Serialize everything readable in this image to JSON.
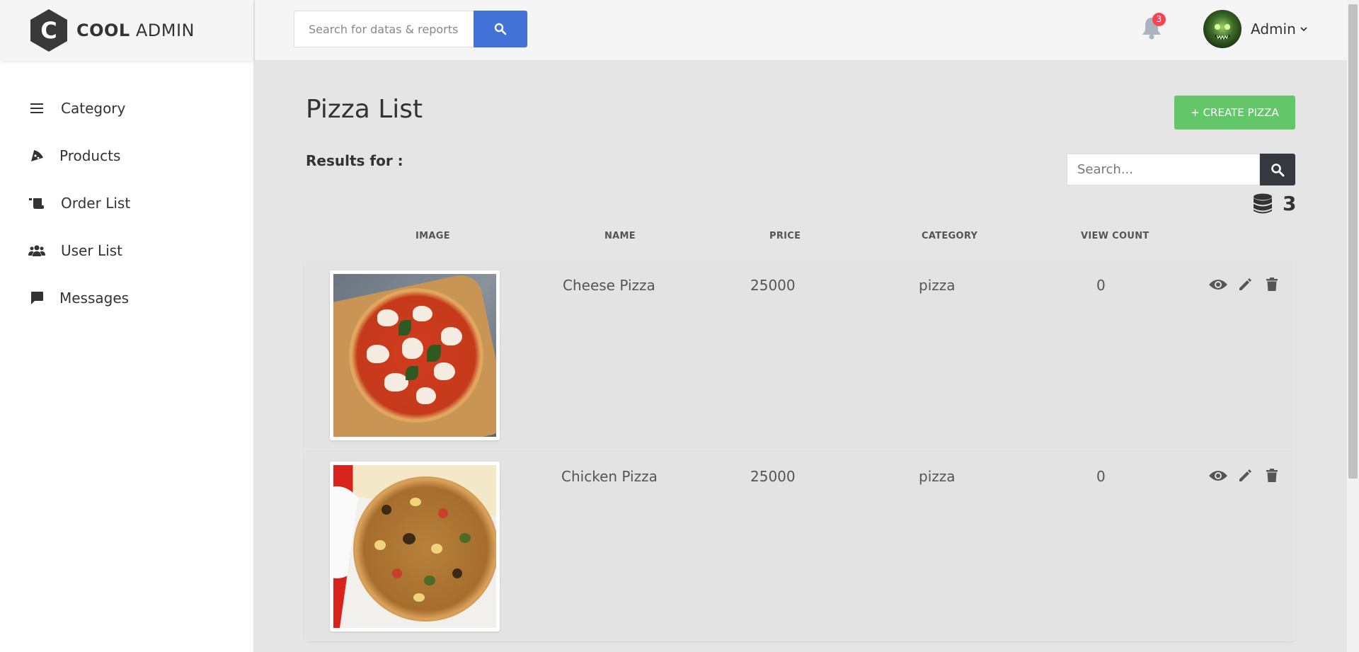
{
  "brand": {
    "name_bold": "COOL",
    "name_rest": " ADMIN",
    "logo_letter": "C"
  },
  "sidebar": {
    "items": [
      {
        "label": "Category",
        "icon": "menu-icon"
      },
      {
        "label": "Products",
        "icon": "pizza-slice-icon"
      },
      {
        "label": "Order List",
        "icon": "receipt-icon"
      },
      {
        "label": "User List",
        "icon": "users-icon"
      },
      {
        "label": "Messages",
        "icon": "message-icon"
      }
    ]
  },
  "header": {
    "search_placeholder": "Search for datas & reports...",
    "notification_count": "3",
    "account_name": "Admin"
  },
  "main": {
    "title": "Pizza List",
    "create_label": "+ CREATE PIZZA",
    "results_label": "Results for :",
    "search_placeholder": "Search...",
    "total_count": "3",
    "columns": [
      "IMAGE",
      "NAME",
      "PRICE",
      "CATEGORY",
      "VIEW COUNT"
    ],
    "rows": [
      {
        "name": "Cheese Pizza",
        "price": "25000",
        "category": "pizza",
        "view_count": "0"
      },
      {
        "name": "Chicken Pizza",
        "price": "25000",
        "category": "pizza",
        "view_count": "0"
      }
    ]
  },
  "colors": {
    "accent_blue": "#4272d7",
    "create_green": "#63c76a",
    "badge_red": "#fa4251",
    "dark_button": "#343a40"
  }
}
